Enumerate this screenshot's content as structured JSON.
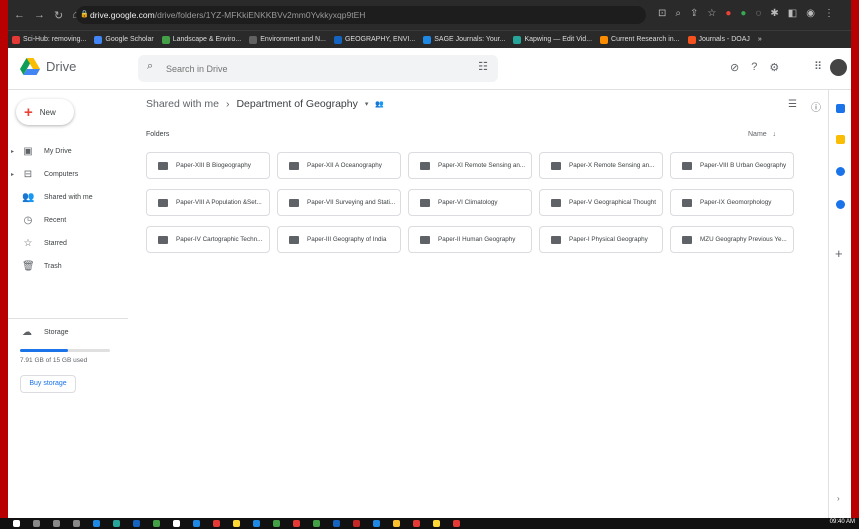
{
  "browser": {
    "url_host": "drive.google.com",
    "url_path": "/drive/folders/1YZ-MFKkiENKKBVv2mm0Yvkkyxqp9tEH",
    "bookmarks": [
      {
        "label": "Sci-Hub: removing...",
        "color": "#e53935"
      },
      {
        "label": "Google Scholar",
        "color": "#4285f4"
      },
      {
        "label": "Landscape & Enviro...",
        "color": "#43a047"
      },
      {
        "label": "Environment and N...",
        "color": "#616161"
      },
      {
        "label": "GEOGRAPHY, ENVI...",
        "color": "#1565c0"
      },
      {
        "label": "SAGE Journals: Your...",
        "color": "#1e88e5"
      },
      {
        "label": "Kapwing — Edit Vid...",
        "color": "#26a69a"
      },
      {
        "label": "Current Research in...",
        "color": "#fb8c00"
      },
      {
        "label": "Journals - DOAJ",
        "color": "#f4511e"
      }
    ],
    "more": "»"
  },
  "header": {
    "app_name": "Drive",
    "search_placeholder": "Search in Drive"
  },
  "sidebar": {
    "new_label": "New",
    "items": [
      {
        "label": "My Drive",
        "icon": "my-drive-icon",
        "glyph": "▣",
        "arrow": "▸"
      },
      {
        "label": "Computers",
        "icon": "computers-icon",
        "glyph": "⊟",
        "arrow": "▸"
      },
      {
        "label": "Shared with me",
        "icon": "shared-icon",
        "glyph": "👥",
        "arrow": ""
      },
      {
        "label": "Recent",
        "icon": "clock-icon",
        "glyph": "◷",
        "arrow": ""
      },
      {
        "label": "Starred",
        "icon": "star-icon",
        "glyph": "☆",
        "arrow": ""
      },
      {
        "label": "Trash",
        "icon": "trash-icon",
        "glyph": "🗑",
        "arrow": ""
      }
    ],
    "storage_label": "Storage",
    "storage_used_fraction": 0.53,
    "storage_text": "7.91 GB of 15 GB used",
    "buy_label": "Buy storage"
  },
  "main": {
    "breadcrumb_parent": "Shared with me",
    "breadcrumb_separator": "›",
    "breadcrumb_current": "Department of Geography",
    "folders_label": "Folders",
    "sort_label": "Name",
    "folders": [
      "Paper-XIII B Biogeography",
      "Paper-XII A Oceanography",
      "Paper-XI Remote Sensing an...",
      "Paper-X Remote Sensing an...",
      "Paper-VIII B Urban Geography",
      "Paper-VIII A Population &Set...",
      "Paper-VII Surveying and Stati...",
      "Paper-VI Climatology",
      "Paper-V Geographical Thought",
      "Paper-IX Geomorphology",
      "Paper-IV Cartographic Techn...",
      "Paper-III Geography of India",
      "Paper-II Human Geography",
      "Paper-I Physical Geography",
      "MZU Geography Previous Ye..."
    ]
  },
  "rightbar": {
    "apps": [
      {
        "icon": "calendar-icon",
        "color": "#1a73e8"
      },
      {
        "icon": "keep-icon",
        "color": "#fbbc04"
      },
      {
        "icon": "tasks-icon",
        "color": "#1a73e8"
      },
      {
        "icon": "contacts-icon",
        "color": "#1a73e8"
      }
    ]
  },
  "taskbar": {
    "clock": "09:40 AM"
  }
}
